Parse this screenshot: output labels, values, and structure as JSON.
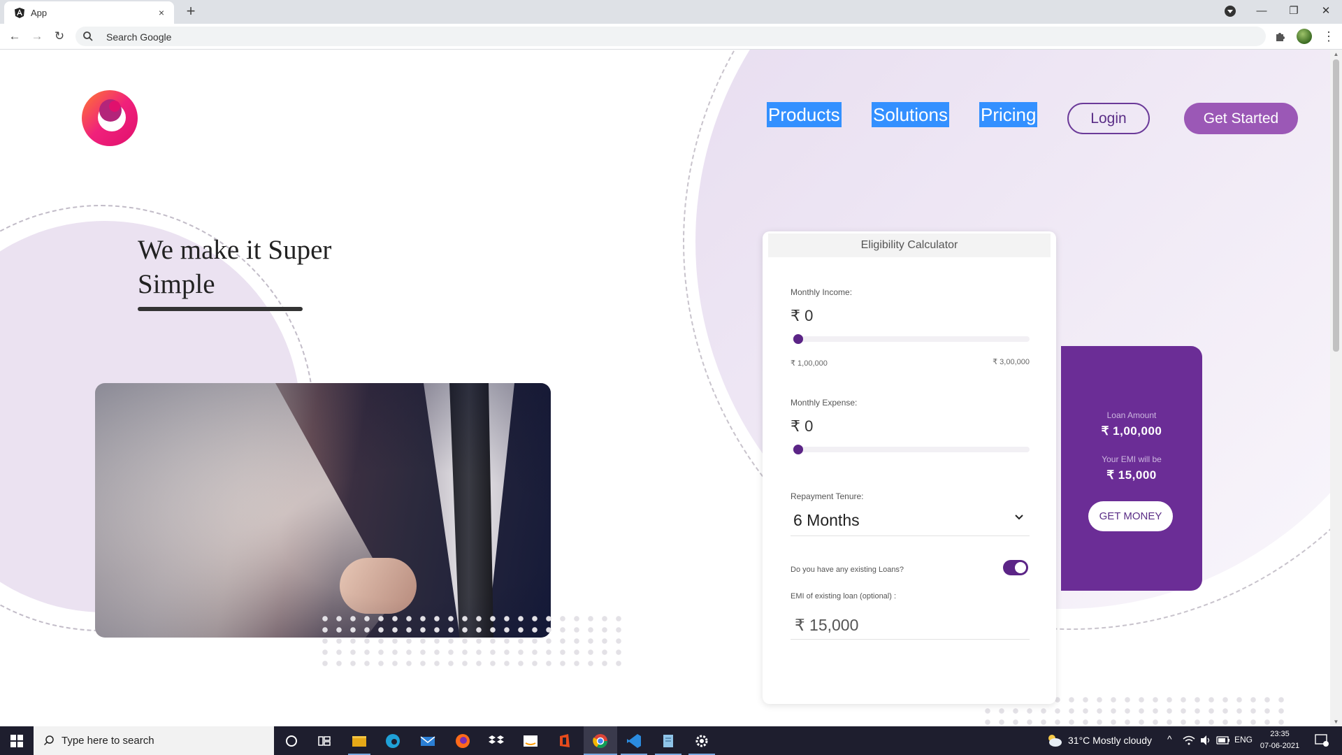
{
  "browser": {
    "tab_title": "App",
    "tab_close": "×",
    "new_tab": "+",
    "omnibox_placeholder": "Search Google",
    "window_controls": {
      "minimize": "—",
      "restore": "❐",
      "close": "✕"
    },
    "nav": {
      "back": "←",
      "forward": "→",
      "reload": "↻"
    },
    "menu": "⋮"
  },
  "site": {
    "logo": "brand-logo",
    "nav_links": [
      "Products",
      "Solutions",
      "Pricing"
    ],
    "login_label": "Login",
    "get_started_label": "Get Started",
    "highlight_color": "#3390ff",
    "accent_color": "#6b2d96"
  },
  "hero": {
    "title": "We make it Super Simple"
  },
  "calculator": {
    "title": "Eligibility Calculator",
    "monthly_income_label": "Monthly Income:",
    "monthly_income_value": "₹ 0",
    "income_slider": {
      "value_fraction": 0
    },
    "income_min_label": "₹ 1,00,000",
    "income_max_label": "₹ 3,00,000",
    "monthly_expense_label": "Monthly Expense:",
    "monthly_expense_value": "₹ 0",
    "expense_slider": {
      "value_fraction": 0
    },
    "tenure_label": "Repayment Tenure:",
    "tenure_value": "6 Months",
    "existing_loans_label": "Do you have any existing Loans?",
    "existing_loans_on": true,
    "emi_label": "EMI of existing loan (optional) :",
    "emi_value": "₹ 15,000"
  },
  "loan_summary": {
    "loan_amount_label": "Loan Amount",
    "loan_amount_value": "₹ 1,00,000",
    "emi_label": "Your EMI will be",
    "emi_value": "₹ 15,000",
    "cta": "GET MONEY"
  },
  "taskbar": {
    "search_placeholder": "Type here to search",
    "weather": "31°C  Mostly cloudy",
    "language": "ENG",
    "time": "23:35",
    "date": "07-06-2021",
    "apps": [
      "cortana-icon",
      "task-view-icon",
      "file-explorer-icon",
      "edge-icon",
      "mail-icon",
      "firefox-icon",
      "dropbox-icon",
      "amazon-icon",
      "office-icon",
      "chrome-icon",
      "vscode-icon",
      "notepad-icon",
      "settings-icon"
    ]
  }
}
